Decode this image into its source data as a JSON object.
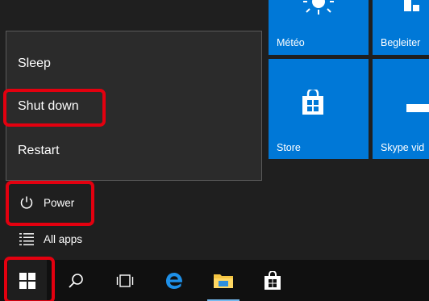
{
  "tiles": {
    "weather": {
      "label": "Météo",
      "icon": "sun-icon"
    },
    "people": {
      "label": "Begleiter",
      "icon": "people-icon"
    },
    "store": {
      "label": "Store",
      "icon": "store-bag-icon"
    },
    "skype": {
      "label": "Skype vid",
      "icon": "skype-video-icon"
    }
  },
  "power_flyout": {
    "items": [
      {
        "label": "Sleep"
      },
      {
        "label": "Shut down",
        "highlighted": true
      },
      {
        "label": "Restart"
      }
    ]
  },
  "rail": {
    "power_label": "Power",
    "all_apps_label": "All apps"
  },
  "taskbar": {
    "buttons": [
      {
        "name": "start",
        "icon": "windows-logo-icon",
        "highlighted": true
      },
      {
        "name": "search",
        "icon": "search-icon"
      },
      {
        "name": "task-view",
        "icon": "task-view-icon"
      },
      {
        "name": "edge",
        "icon": "edge-icon"
      },
      {
        "name": "file-explorer",
        "icon": "folder-icon",
        "active": true
      },
      {
        "name": "store",
        "icon": "store-bag-icon"
      }
    ]
  },
  "colors": {
    "tile_blue": "#0078d7",
    "annotation_red": "#e3000f",
    "menu_bg": "#1f1f1f",
    "flyout_bg": "#2b2b2b",
    "taskbar_bg": "#101010"
  }
}
